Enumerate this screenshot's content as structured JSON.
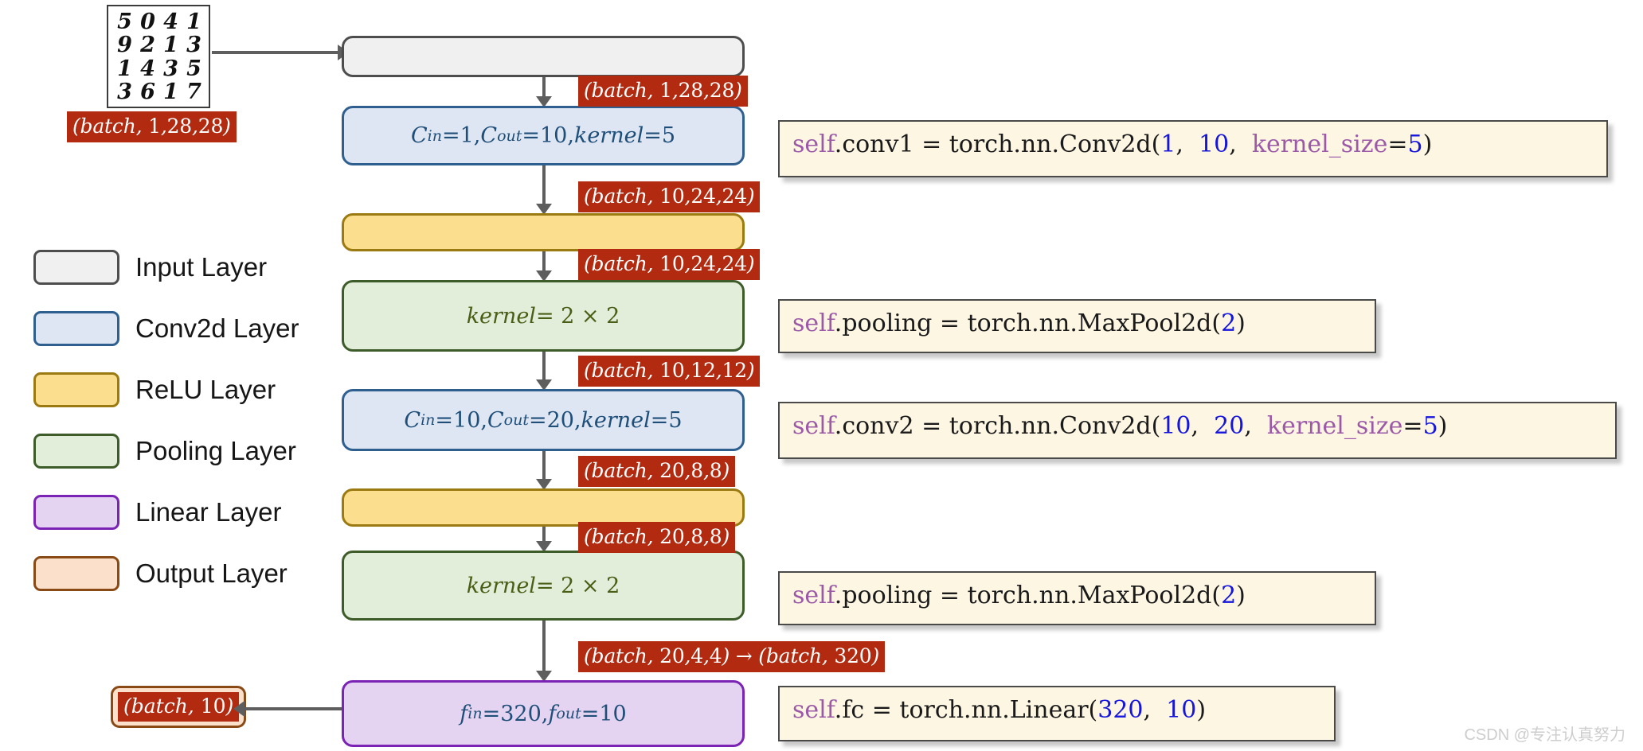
{
  "title": "PyTorch CNN (MNIST) architecture diagram",
  "input_sample": {
    "name": "mnist-digit-grid",
    "rows": [
      [
        "5",
        "0",
        "4",
        "1"
      ],
      [
        "9",
        "2",
        "1",
        "3"
      ],
      [
        "1",
        "4",
        "3",
        "5"
      ],
      [
        "3",
        "6",
        "1",
        "7"
      ]
    ],
    "shape_label": "(batch, 1,28,28)"
  },
  "legend": {
    "items": [
      {
        "label": "Input Layer",
        "fill": "#f0f0f0",
        "border": "#4d4d4d"
      },
      {
        "label": "Conv2d Layer",
        "fill": "#dde6f2",
        "border": "#2e5f8f"
      },
      {
        "label": "ReLU Layer",
        "fill": "#fbdf8e",
        "border": "#9b7a12"
      },
      {
        "label": "Pooling Layer",
        "fill": "#e2eeda",
        "border": "#3d5c2a"
      },
      {
        "label": "Linear Layer",
        "fill": "#e4d4f2",
        "border": "#7b23b5"
      },
      {
        "label": "Output Layer",
        "fill": "#fbe0cb",
        "border": "#8a4a16"
      }
    ]
  },
  "flow": {
    "boxes": [
      {
        "name": "input-layer-box",
        "kind": "input",
        "text": "",
        "fill": "#f0f0f0",
        "border": "#4d4d4d",
        "text_color": "#4d4d4d"
      },
      {
        "name": "conv1-box",
        "kind": "conv",
        "text": "C_in = 1, C_out = 10, kernel = 5",
        "c_in": "1",
        "c_out": "10",
        "kernel": "5",
        "fill": "#dde6f2",
        "border": "#2e5f8f",
        "text_color": "#1f4e79"
      },
      {
        "name": "relu1-box",
        "kind": "relu",
        "text": "",
        "fill": "#fbdf8e",
        "border": "#9b7a12",
        "text_color": "#7a5c00"
      },
      {
        "name": "pooling1-box",
        "kind": "pool",
        "text": "kernel = 2 × 2",
        "kernel": "2 × 2",
        "fill": "#e2eeda",
        "border": "#3d5c2a",
        "text_color": "#4a5e16"
      },
      {
        "name": "conv2-box",
        "kind": "conv",
        "text": "C_in = 10, C_out = 20, kernel = 5",
        "c_in": "10",
        "c_out": "20",
        "kernel": "5",
        "fill": "#dde6f2",
        "border": "#2e5f8f",
        "text_color": "#1f4e79"
      },
      {
        "name": "relu2-box",
        "kind": "relu",
        "text": "",
        "fill": "#fbdf8e",
        "border": "#9b7a12",
        "text_color": "#7a5c00"
      },
      {
        "name": "pooling2-box",
        "kind": "pool",
        "text": "kernel = 2 × 2",
        "kernel": "2 × 2",
        "fill": "#e2eeda",
        "border": "#3d5c2a",
        "text_color": "#4a5e16"
      },
      {
        "name": "linear-box",
        "kind": "linear",
        "text": "f_in = 320, f_out = 10",
        "f_in": "320",
        "f_out": "10",
        "fill": "#e4d4f2",
        "border": "#7b23b5",
        "text_color": "#1f4e79"
      }
    ]
  },
  "shape_labels": [
    {
      "name": "shape-after-input",
      "text": "(batch, 1,28,28)"
    },
    {
      "name": "shape-after-conv1",
      "text": "(batch, 10,24,24)"
    },
    {
      "name": "shape-after-relu1",
      "text": "(batch, 10,24,24)"
    },
    {
      "name": "shape-after-pool1",
      "text": "(batch, 10,12,12)"
    },
    {
      "name": "shape-after-conv2",
      "text": "(batch, 20,8,8)"
    },
    {
      "name": "shape-after-relu2",
      "text": "(batch, 20,8,8)"
    },
    {
      "name": "shape-after-pool2",
      "text": "(batch, 20,4,4) → (batch, 320)"
    }
  ],
  "output_shape": "(batch, 10)",
  "code_boxes": [
    {
      "name": "code-conv1",
      "text": "self.conv1 = torch.nn.Conv2d(1, 10, kernel_size=5)",
      "tokens": [
        {
          "t": "self",
          "c": "self"
        },
        {
          "t": ".conv1 = torch.nn.Conv2d(",
          "c": "plain"
        },
        {
          "t": "1",
          "c": "num"
        },
        {
          "t": ",  ",
          "c": "plain"
        },
        {
          "t": "10",
          "c": "num"
        },
        {
          "t": ",  ",
          "c": "plain"
        },
        {
          "t": "kernel_size",
          "c": "kw"
        },
        {
          "t": "=",
          "c": "plain"
        },
        {
          "t": "5",
          "c": "num"
        },
        {
          "t": ")",
          "c": "plain"
        }
      ]
    },
    {
      "name": "code-pooling-1",
      "text": "self.pooling = torch.nn.MaxPool2d(2)",
      "tokens": [
        {
          "t": "self",
          "c": "self"
        },
        {
          "t": ".pooling = torch.nn.MaxPool2d(",
          "c": "plain"
        },
        {
          "t": "2",
          "c": "num"
        },
        {
          "t": ")",
          "c": "plain"
        }
      ]
    },
    {
      "name": "code-conv2",
      "text": "self.conv2 = torch.nn.Conv2d(10, 20, kernel_size=5)",
      "tokens": [
        {
          "t": "self",
          "c": "self"
        },
        {
          "t": ".conv2 = torch.nn.Conv2d(",
          "c": "plain"
        },
        {
          "t": "10",
          "c": "num"
        },
        {
          "t": ",  ",
          "c": "plain"
        },
        {
          "t": "20",
          "c": "num"
        },
        {
          "t": ",  ",
          "c": "plain"
        },
        {
          "t": "kernel_size",
          "c": "kw"
        },
        {
          "t": "=",
          "c": "plain"
        },
        {
          "t": "5",
          "c": "num"
        },
        {
          "t": ")",
          "c": "plain"
        }
      ]
    },
    {
      "name": "code-pooling-2",
      "text": "self.pooling = torch.nn.MaxPool2d(2)",
      "tokens": [
        {
          "t": "self",
          "c": "self"
        },
        {
          "t": ".pooling = torch.nn.MaxPool2d(",
          "c": "plain"
        },
        {
          "t": "2",
          "c": "num"
        },
        {
          "t": ")",
          "c": "plain"
        }
      ]
    },
    {
      "name": "code-fc",
      "text": "self.fc = torch.nn.Linear(320, 10)",
      "tokens": [
        {
          "t": "self",
          "c": "self"
        },
        {
          "t": ".fc = torch.nn.Linear(",
          "c": "plain"
        },
        {
          "t": "320",
          "c": "num"
        },
        {
          "t": ",  ",
          "c": "plain"
        },
        {
          "t": "10",
          "c": "num"
        },
        {
          "t": ")",
          "c": "plain"
        }
      ]
    }
  ],
  "watermark": "CSDN @专注认真努力",
  "colors": {
    "shape_label_bg": "#b22a10",
    "code_bg": "#fdf6e3",
    "arrow": "#5e5e5e"
  }
}
